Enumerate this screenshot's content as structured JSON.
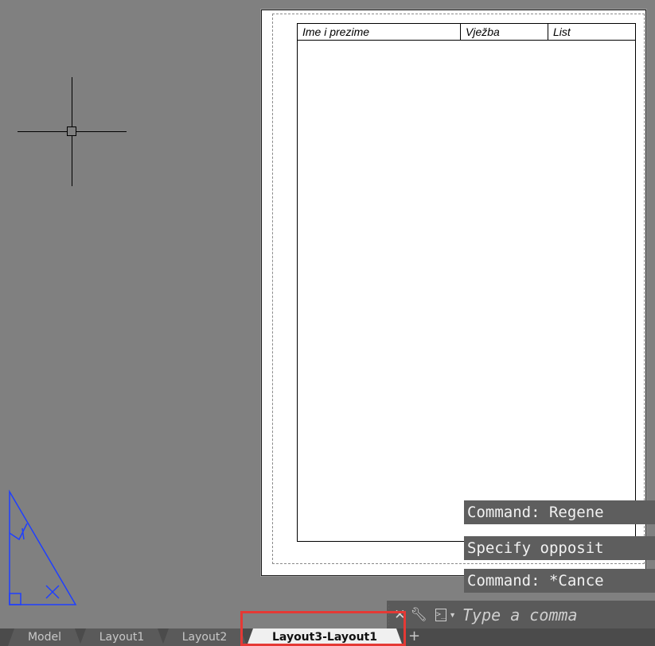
{
  "title_block": {
    "name_label": "Ime i prezime",
    "exercise_label": "Vježba",
    "sheet_label": "List"
  },
  "command_history": [
    "Command: Regene",
    "Specify opposit",
    "Command: *Cance"
  ],
  "command_input": {
    "placeholder": "Type a comma"
  },
  "layout_tabs": {
    "items": [
      "Model",
      "Layout1",
      "Layout2",
      "Layout3-Layout1"
    ],
    "active": "Layout3-Layout1",
    "add_label": "+"
  },
  "icons": {
    "close": "close-icon",
    "customize": "wrench-icon",
    "prompt": "command-prompt-icon"
  },
  "colors": {
    "canvas": "#808080",
    "ucs_icon": "#1f3fff",
    "highlight": "#e53935"
  }
}
